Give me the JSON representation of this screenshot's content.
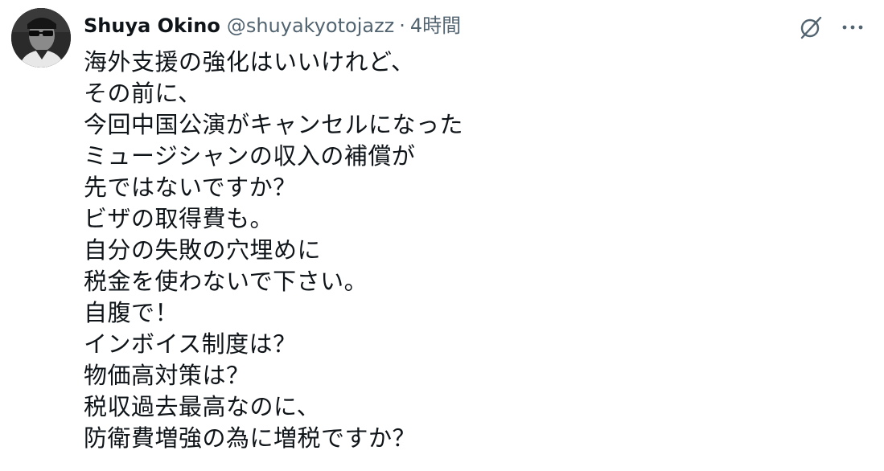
{
  "author": {
    "display_name": "Shuya Okino",
    "handle": "@shuyakyotojazz",
    "separator": "·",
    "time": "4時間"
  },
  "icons": {
    "avatar": "avatar-image",
    "grok": "grok-icon",
    "more": "more-options-icon"
  },
  "colors": {
    "text": "#0f1419",
    "secondary": "#536471"
  },
  "tweet": {
    "lines": [
      "海外支援の強化はいいけれど、",
      "その前に、",
      "今回中国公演がキャンセルになった",
      "ミュージシャンの収入の補償が",
      "先ではないですか？",
      "ビザの取得費も。",
      "自分の失敗の穴埋めに",
      "税金を使わないで下さい。",
      "自腹で！",
      "インボイス制度は？",
      "物価高対策は？",
      "税収過去最高なのに、",
      "防衛費増強の為に増税ですか？"
    ]
  }
}
